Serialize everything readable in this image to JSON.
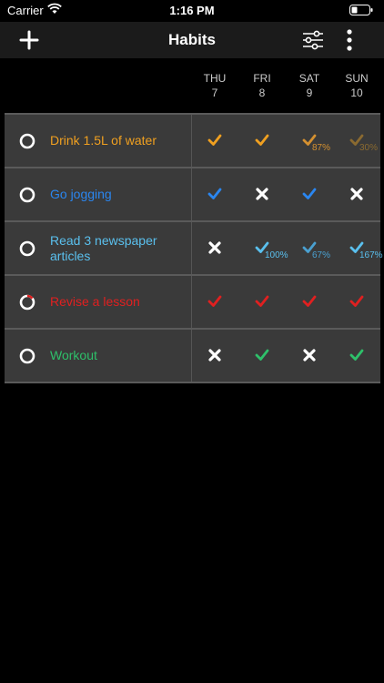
{
  "status": {
    "carrier": "Carrier",
    "time": "1:16 PM"
  },
  "nav": {
    "title": "Habits"
  },
  "days": [
    {
      "name": "THU",
      "num": "7"
    },
    {
      "name": "FRI",
      "num": "8"
    },
    {
      "name": "SAT",
      "num": "9"
    },
    {
      "name": "SUN",
      "num": "10"
    }
  ],
  "habits": [
    {
      "name": "Drink 1.5L of water",
      "color": "#f0a020",
      "cells": [
        {
          "mark": "check",
          "color": "#f0a020",
          "pct": ""
        },
        {
          "mark": "check",
          "color": "#f0a020",
          "pct": ""
        },
        {
          "mark": "check",
          "color": "#d49030",
          "pct": "87%"
        },
        {
          "mark": "check",
          "color": "#8a6a30",
          "pct": "30%"
        }
      ]
    },
    {
      "name": "Go jogging",
      "color": "#2a86f0",
      "cells": [
        {
          "mark": "check",
          "color": "#2a86f0",
          "pct": ""
        },
        {
          "mark": "cross",
          "color": "#ffffff",
          "pct": ""
        },
        {
          "mark": "check",
          "color": "#2a86f0",
          "pct": ""
        },
        {
          "mark": "cross",
          "color": "#ffffff",
          "pct": ""
        }
      ]
    },
    {
      "name": "Read 3 newspaper articles",
      "color": "#5ac0ee",
      "cells": [
        {
          "mark": "cross",
          "color": "#ffffff",
          "pct": ""
        },
        {
          "mark": "check",
          "color": "#5ac0ee",
          "pct": "100%"
        },
        {
          "mark": "check",
          "color": "#4aa0d0",
          "pct": "67%"
        },
        {
          "mark": "check",
          "color": "#5ac0ee",
          "pct": "167%"
        }
      ]
    },
    {
      "name": "Revise a lesson",
      "color": "#e02020",
      "cells": [
        {
          "mark": "check",
          "color": "#e02020",
          "pct": ""
        },
        {
          "mark": "check",
          "color": "#e02020",
          "pct": ""
        },
        {
          "mark": "check",
          "color": "#e02020",
          "pct": ""
        },
        {
          "mark": "check",
          "color": "#e02020",
          "pct": ""
        }
      ]
    },
    {
      "name": "Workout",
      "color": "#2ec06a",
      "cells": [
        {
          "mark": "cross",
          "color": "#ffffff",
          "pct": ""
        },
        {
          "mark": "check",
          "color": "#2ec06a",
          "pct": ""
        },
        {
          "mark": "cross",
          "color": "#ffffff",
          "pct": ""
        },
        {
          "mark": "check",
          "color": "#2ec06a",
          "pct": ""
        }
      ]
    }
  ],
  "colors": {
    "ring_track": "#ffffff",
    "ring_progress_revise": "#e02020"
  }
}
